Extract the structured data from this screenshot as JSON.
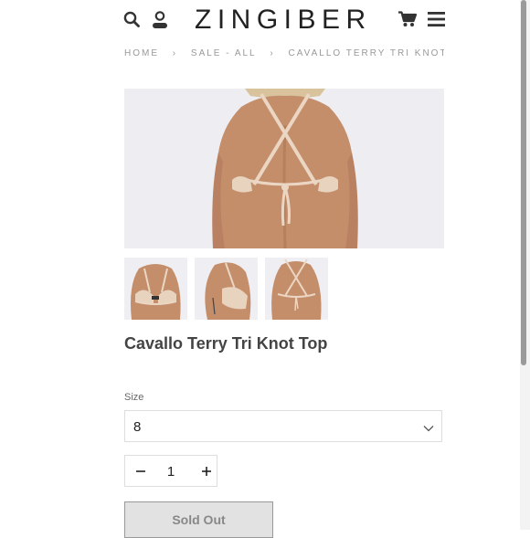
{
  "header": {
    "logo": "ZINGIBER",
    "icons": [
      "search-icon",
      "user-icon",
      "cart-icon",
      "menu-icon"
    ]
  },
  "breadcrumb": [
    "HOME",
    "SALE - ALL",
    "CAVALLO TERRY TRI KNOT TOP"
  ],
  "product": {
    "title": "Cavallo Terry Tri Knot Top",
    "size_label": "Size",
    "size_value": "8",
    "quantity": "1",
    "sold_out_label": "Sold Out"
  },
  "colors": {
    "photo_bg": "#eeedf2",
    "skin": "#c48e6b",
    "bikini": "#e8d3bf"
  }
}
